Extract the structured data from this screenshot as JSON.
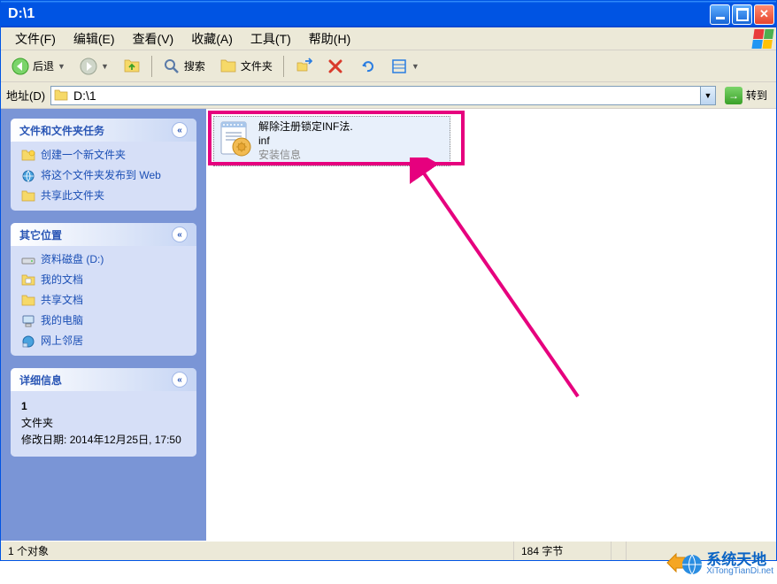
{
  "window": {
    "title": "D:\\1"
  },
  "menu": {
    "file": "文件(F)",
    "edit": "编辑(E)",
    "view": "查看(V)",
    "fav": "收藏(A)",
    "tools": "工具(T)",
    "help": "帮助(H)"
  },
  "toolbar": {
    "back": "后退",
    "search": "搜索",
    "folders": "文件夹"
  },
  "address": {
    "label": "地址(D)",
    "value": "D:\\1",
    "go": "转到"
  },
  "sidebar": {
    "tasks": {
      "title": "文件和文件夹任务",
      "items": [
        {
          "label": "创建一个新文件夹",
          "icon": "new-folder"
        },
        {
          "label": "将这个文件夹发布到 Web",
          "icon": "publish-web"
        },
        {
          "label": "共享此文件夹",
          "icon": "share-folder"
        }
      ]
    },
    "places": {
      "title": "其它位置",
      "items": [
        {
          "label": "资料磁盘 (D:)",
          "icon": "drive"
        },
        {
          "label": "我的文档",
          "icon": "my-docs"
        },
        {
          "label": "共享文档",
          "icon": "shared-docs"
        },
        {
          "label": "我的电脑",
          "icon": "my-computer"
        },
        {
          "label": "网上邻居",
          "icon": "network"
        }
      ]
    },
    "details": {
      "title": "详细信息",
      "name": "1",
      "type": "文件夹",
      "mod_label": "修改日期:",
      "mod_value": "2014年12月25日, 17:50"
    }
  },
  "file": {
    "name_line1": "解除注册锁定INF法.",
    "name_line2": "inf",
    "type": "安装信息"
  },
  "status": {
    "count": "1 个对象",
    "size": "184 字节"
  },
  "watermark": {
    "name": "系统天地",
    "url": "XiTongTianDi.net"
  }
}
